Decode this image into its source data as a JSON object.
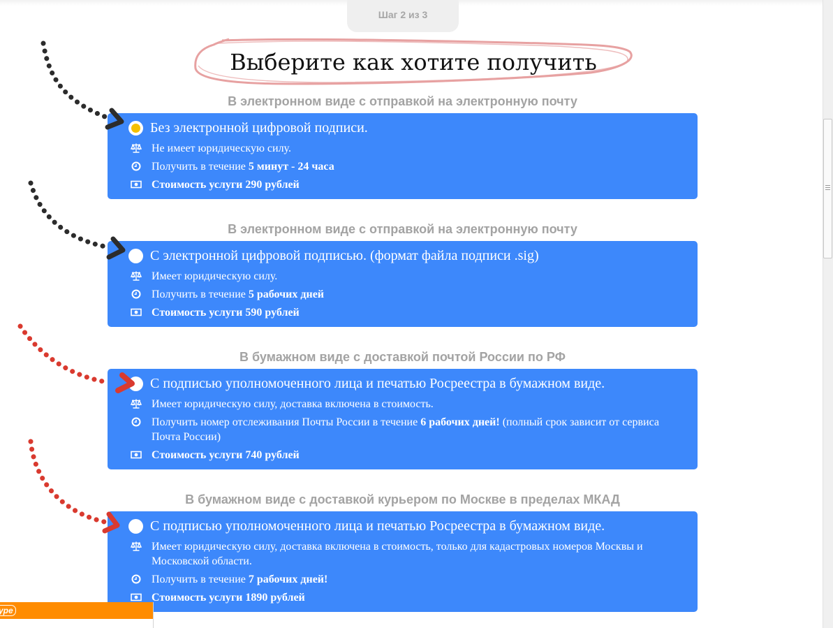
{
  "step": "Шаг 2 из 3",
  "title": "Выберите как хотите получить",
  "sections": [
    {
      "heading": "В электронном виде с отправкой на электронную почту",
      "label": "Без электронной цифровой подписи.",
      "selected": true,
      "legal": "Не имеет юридическую силу.",
      "term_prefix": "Получить в течение ",
      "term_bold": "5 минут - 24 часа",
      "term_suffix": "",
      "price": "Стоимость услуги 290 рублей"
    },
    {
      "heading": "В электронном виде с отправкой на электронную почту",
      "label": "С электронной цифровой подписью. (формат файла подписи .sig)",
      "selected": false,
      "legal": "Имеет юридическую силу.",
      "term_prefix": "Получить в течение ",
      "term_bold": "5 рабочих дней",
      "term_suffix": "",
      "price": "Стоимость услуги 590 рублей"
    },
    {
      "heading": "В бумажном виде с доставкой почтой России по РФ",
      "label": "С подписью уполномоченного лица и печатью Росреестра в бумажном виде.",
      "selected": false,
      "legal": "Имеет юридическую силу, доставка включена в стоимость.",
      "term_prefix": "Получить номер отслеживания Почты России в течение ",
      "term_bold": "6 рабочих дней!",
      "term_suffix": " (полный срок зависит от сервиса Почта России)",
      "price": "Стоимость услуги 740 рублей"
    },
    {
      "heading": "В бумажном виде с доставкой курьером по Москве в пределах МКАД",
      "label": "С подписью уполномоченного лица и печатью Росреестра в бумажном виде.",
      "selected": false,
      "legal": "Имеет юридическую силу, доставка включена в стоимость, только для кадастровых номеров Москвы и Московской области.",
      "term_prefix": "Получить в течение ",
      "term_bold": "7 рабочих дней!",
      "term_suffix": "",
      "price": "Стоимость услуги 1890 рублей"
    }
  ],
  "icons": {
    "legal": "scales-icon",
    "term": "clock-icon",
    "price": "money-icon",
    "radio": "radio-button"
  },
  "chat_widget": {
    "brand": "ype"
  },
  "colors": {
    "card": "#3d88fb",
    "heading": "#a3a3a3",
    "radio_selected": "#f5c000",
    "title_ring": "#e7a1a1",
    "arrow_dark": "#2c2c2c",
    "arrow_red": "#d93a2f",
    "chat_bar": "#ff8c00"
  }
}
